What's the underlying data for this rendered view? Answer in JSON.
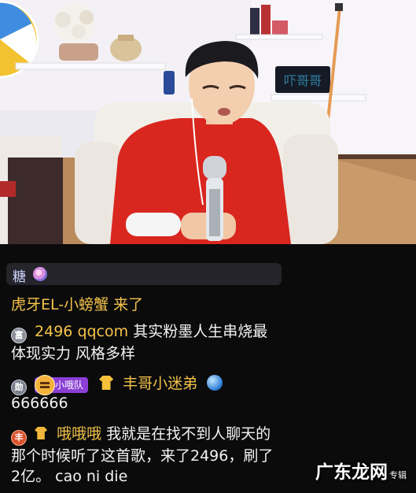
{
  "stream": {
    "video_alt": "live-stream-video-frame"
  },
  "chat": {
    "tag": {
      "label": "糖",
      "icon": "lollipop-icon"
    },
    "messages": [
      {
        "type": "join",
        "user": "虎牙EL-小螃蟹",
        "text": "来了"
      },
      {
        "type": "chat",
        "badge": "富",
        "user": "2496 qqcom",
        "text": "其实粉墨人生串烧最体现实力 风格多样"
      },
      {
        "type": "chat",
        "badge": "勋",
        "team_badge": "小哦队",
        "user": "丰哥小迷弟",
        "text": "666666"
      },
      {
        "type": "chat",
        "badge": "丰",
        "user": "哦哦哦",
        "text": "我就是在找不到人聊天的那个时候听了这首歌，来了2496，刷了2亿。 cao ni die"
      }
    ]
  },
  "watermark": {
    "text": "广东龙网",
    "small": "专辑"
  },
  "colors": {
    "background": "#0b0b0c",
    "username": "#f5c34a",
    "message": "#f2f2f2",
    "team_badge": "#8b3fd6",
    "shirt": "#d9261f"
  }
}
